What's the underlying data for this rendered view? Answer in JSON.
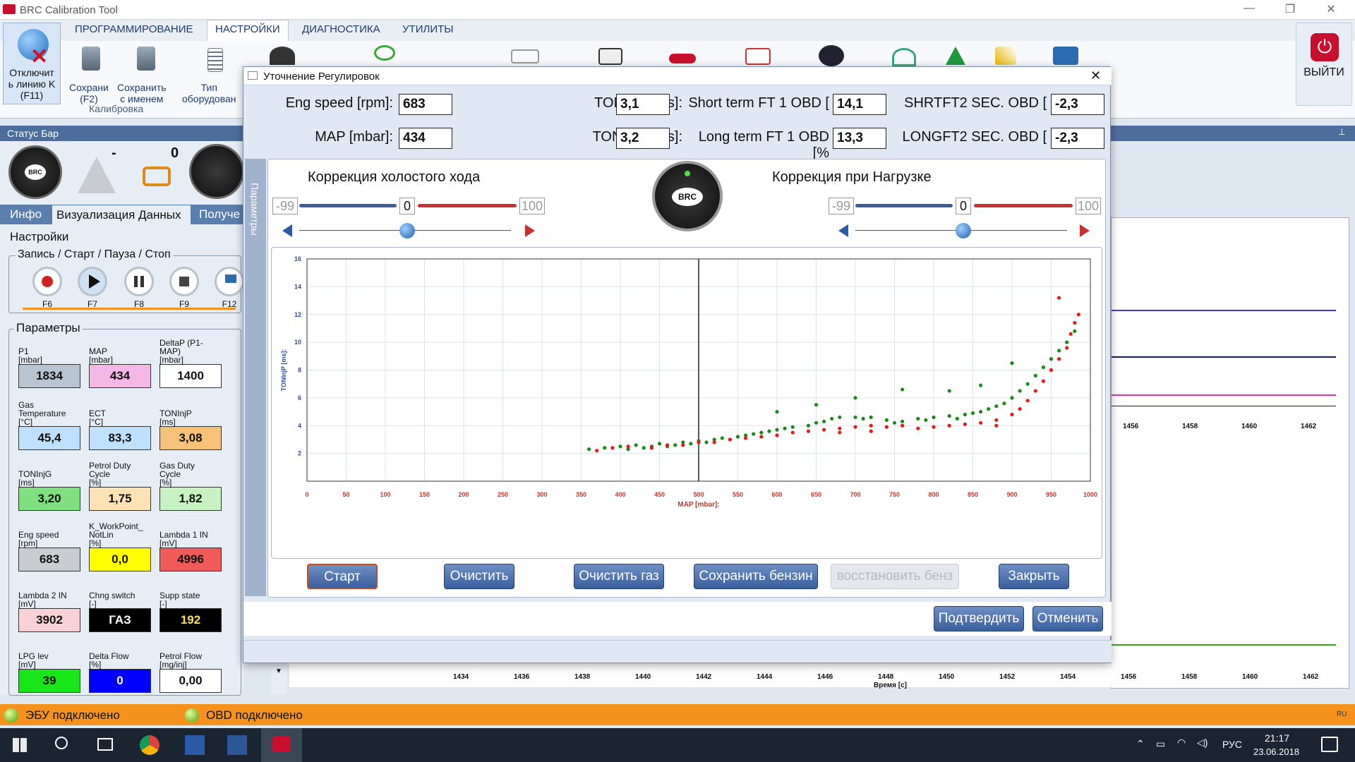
{
  "app": {
    "title": "BRC Calibration Tool"
  },
  "ribbon": {
    "tabs": [
      "ПРОГРАММИРОВАНИЕ",
      "НАСТРОЙКИ",
      "ДИАГНОСТИКА",
      "УТИЛИТЫ"
    ],
    "disconnect": "Отключит\nь линию K\n(F11)",
    "save": "Сохрани\n(F2)",
    "save_as": "Сохранить\nс именем",
    "group": "Калибровка",
    "equip": "Тип\nоборудован",
    "exit": "ВЫЙТИ"
  },
  "status_head": "Статус Бар",
  "status": {
    "warning": "-",
    "engine": "0"
  },
  "left_tabs": [
    "Инфо",
    "Визуализация Данных",
    "Получе"
  ],
  "settings": {
    "title": "Настройки",
    "record_group": "Запись / Старт / Пауза / Стоп",
    "keys": [
      "F6",
      "F7",
      "F8",
      "F9",
      "F12"
    ]
  },
  "params": {
    "title": "Параметры",
    "items": [
      {
        "label": "P1\n[mbar]",
        "value": "1834",
        "color": "#b9c4d3"
      },
      {
        "label": "MAP\n[mbar]",
        "value": "434",
        "color": "#f5b8e6"
      },
      {
        "label": "DeltaP (P1-\nMAP)\n[mbar]",
        "value": "1400",
        "color": "#ffffff"
      },
      {
        "label": "Gas\nTemperature\n[°C]",
        "value": "45,4",
        "color": "#bfe1ff"
      },
      {
        "label": "ECT\n[°C]",
        "value": "83,3",
        "color": "#bfe1ff"
      },
      {
        "label": "TONInjP\n[ms]",
        "value": "3,08",
        "color": "#f6c27a"
      },
      {
        "label": "TONInjG\n[ms]",
        "value": "3,20",
        "color": "#7fe07f"
      },
      {
        "label": "Petrol Duty\nCycle\n[%]",
        "value": "1,75",
        "color": "#fde2b6"
      },
      {
        "label": "Gas Duty\nCycle\n[%]",
        "value": "1,82",
        "color": "#c9f2c3"
      },
      {
        "label": "Eng speed\n[rpm]",
        "value": "683",
        "color": "#c9ccd1"
      },
      {
        "label": "K_WorkPoint_\nNotLin\n[%]",
        "value": "0,0",
        "color": "#ffff00"
      },
      {
        "label": "Lambda 1 IN\n[mV]",
        "value": "4996",
        "color": "#f25a5a"
      },
      {
        "label": "Lambda 2 IN\n[mV]",
        "value": "3902",
        "color": "#fbd1d8"
      },
      {
        "label": "Chng switch\n[-]",
        "value": "ГАЗ",
        "color": "#000000"
      },
      {
        "label": "Supp state\n[-]",
        "value": "192",
        "color": "#000000"
      },
      {
        "label": "LPG lev\n[mV]",
        "value": "39",
        "color": "#19e619"
      },
      {
        "label": "Delta Flow\n[%]",
        "value": "0",
        "color": "#0000ff"
      },
      {
        "label": "Petrol Flow\n[mg/inj]",
        "value": "0,00",
        "color": "#ffffff"
      }
    ]
  },
  "dialog": {
    "title": "Уточнение Регулировок",
    "fields": [
      {
        "label": "Eng speed [rpm]:",
        "value": "683"
      },
      {
        "label": "TONInjP [ms]:",
        "value": "3,1"
      },
      {
        "label": "Short term FT 1 OBD [",
        "value": "14,1"
      },
      {
        "label": "SHRTFT2 SEC. OBD [",
        "value": "-2,3"
      },
      {
        "label": "MAP [mbar]:",
        "value": "434"
      },
      {
        "label": "TONInjG [ms]:",
        "value": "3,2"
      },
      {
        "label": "Long term FT 1 OBD [%",
        "value": "13,3"
      },
      {
        "label": "LONGFT2 SEC. OBD [",
        "value": "-2,3"
      }
    ],
    "side_tab": "Параметры",
    "idle": {
      "title": "Коррекция холостого хода",
      "min": "-99",
      "val": "0",
      "max": "100"
    },
    "load": {
      "title": "Коррекция при Нагрузке",
      "min": "-99",
      "val": "0",
      "max": "100"
    },
    "buttons": [
      "Старт",
      "Очистить",
      "Очистить газ",
      "Сохранить бензин",
      "восстановить бенз",
      "Закрыть"
    ],
    "confirm": "Подтвердить",
    "cancel": "Отменить"
  },
  "chart_data": {
    "type": "scatter",
    "xlabel": "MAP [mbar]:",
    "ylabel": "TONInjP [ms]:",
    "xlim": [
      0,
      1000
    ],
    "ylim": [
      0,
      16
    ],
    "xticks": [
      0,
      50,
      100,
      150,
      200,
      250,
      300,
      350,
      400,
      450,
      500,
      550,
      600,
      650,
      700,
      750,
      800,
      850,
      900,
      950,
      1000
    ],
    "yticks": [
      2,
      4,
      6,
      8,
      10,
      12,
      14,
      16
    ],
    "cursor_x": 500,
    "series": [
      {
        "color": "#1a8a1a",
        "points": [
          [
            360,
            2.3
          ],
          [
            380,
            2.4
          ],
          [
            400,
            2.5
          ],
          [
            410,
            2.3
          ],
          [
            420,
            2.6
          ],
          [
            430,
            2.4
          ],
          [
            440,
            2.5
          ],
          [
            450,
            2.7
          ],
          [
            460,
            2.5
          ],
          [
            470,
            2.6
          ],
          [
            480,
            2.8
          ],
          [
            490,
            2.7
          ],
          [
            500,
            2.9
          ],
          [
            510,
            2.8
          ],
          [
            520,
            3.0
          ],
          [
            530,
            3.1
          ],
          [
            540,
            3.0
          ],
          [
            550,
            3.2
          ],
          [
            560,
            3.3
          ],
          [
            570,
            3.4
          ],
          [
            580,
            3.5
          ],
          [
            590,
            3.6
          ],
          [
            600,
            3.7
          ],
          [
            610,
            3.8
          ],
          [
            620,
            3.9
          ],
          [
            640,
            4.0
          ],
          [
            650,
            4.2
          ],
          [
            660,
            4.3
          ],
          [
            670,
            4.5
          ],
          [
            680,
            4.6
          ],
          [
            700,
            4.6
          ],
          [
            710,
            4.5
          ],
          [
            720,
            4.6
          ],
          [
            740,
            4.4
          ],
          [
            750,
            4.2
          ],
          [
            760,
            4.3
          ],
          [
            780,
            4.5
          ],
          [
            790,
            4.4
          ],
          [
            800,
            4.6
          ],
          [
            820,
            4.7
          ],
          [
            830,
            4.5
          ],
          [
            840,
            4.8
          ],
          [
            850,
            4.9
          ],
          [
            860,
            5.0
          ],
          [
            870,
            5.2
          ],
          [
            880,
            5.4
          ],
          [
            890,
            5.6
          ],
          [
            900,
            6.0
          ],
          [
            910,
            6.5
          ],
          [
            920,
            7.0
          ],
          [
            930,
            7.6
          ],
          [
            940,
            8.2
          ],
          [
            950,
            8.8
          ],
          [
            960,
            9.4
          ],
          [
            970,
            10.0
          ],
          [
            980,
            10.8
          ],
          [
            700,
            6.0
          ],
          [
            760,
            6.6
          ],
          [
            820,
            6.5
          ],
          [
            860,
            6.9
          ],
          [
            900,
            8.5
          ],
          [
            600,
            5.0
          ],
          [
            650,
            5.5
          ]
        ]
      },
      {
        "color": "#e01c1c",
        "points": [
          [
            370,
            2.2
          ],
          [
            390,
            2.4
          ],
          [
            410,
            2.5
          ],
          [
            440,
            2.4
          ],
          [
            460,
            2.6
          ],
          [
            480,
            2.6
          ],
          [
            500,
            2.8
          ],
          [
            520,
            2.8
          ],
          [
            540,
            3.0
          ],
          [
            560,
            3.1
          ],
          [
            580,
            3.2
          ],
          [
            600,
            3.3
          ],
          [
            620,
            3.5
          ],
          [
            640,
            3.6
          ],
          [
            660,
            3.7
          ],
          [
            680,
            3.8
          ],
          [
            700,
            3.9
          ],
          [
            720,
            4.0
          ],
          [
            740,
            3.9
          ],
          [
            760,
            4.0
          ],
          [
            780,
            3.8
          ],
          [
            800,
            3.9
          ],
          [
            820,
            4.0
          ],
          [
            840,
            4.1
          ],
          [
            860,
            4.2
          ],
          [
            880,
            4.4
          ],
          [
            900,
            4.8
          ],
          [
            910,
            5.2
          ],
          [
            920,
            5.8
          ],
          [
            930,
            6.5
          ],
          [
            940,
            7.2
          ],
          [
            950,
            8.0
          ],
          [
            960,
            8.8
          ],
          [
            970,
            9.6
          ],
          [
            975,
            10.6
          ],
          [
            980,
            11.4
          ],
          [
            985,
            12.0
          ],
          [
            960,
            13.2
          ],
          [
            880,
            4.0
          ],
          [
            720,
            3.6
          ],
          [
            680,
            3.5
          ]
        ]
      }
    ]
  },
  "conn": {
    "ecu": "ЭБУ подключено",
    "obd": "OBD подключено",
    "lang": "RU"
  },
  "background_axis": {
    "ticks_top": [
      "1456",
      "1458",
      "1460",
      "1462"
    ],
    "ticks_bottom": [
      "1434",
      "1436",
      "1438",
      "1440",
      "1442",
      "1444",
      "1446",
      "1448",
      "1450",
      "1452",
      "1454",
      "1456",
      "1458",
      "1460",
      "1462"
    ],
    "time_label": "Время [с]"
  },
  "taskbar": {
    "lang": "РУС",
    "time": "21:17",
    "date": "23.06.2018"
  }
}
